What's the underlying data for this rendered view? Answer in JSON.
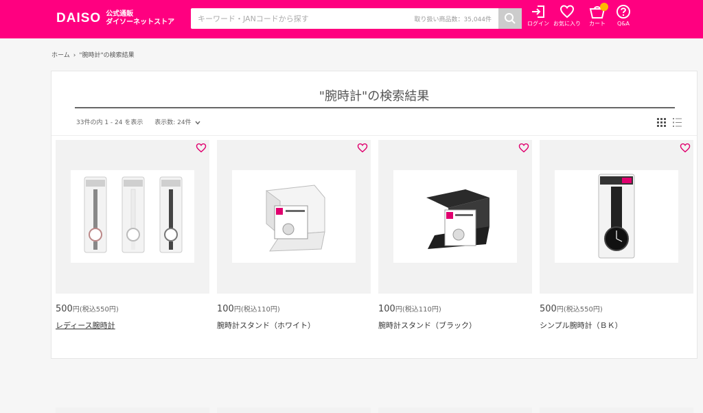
{
  "header": {
    "logo_word": "DAISO",
    "logo_sub_1": "公式通販",
    "logo_sub_2": "ダイソーネットストア",
    "brand_color": "#ff0080",
    "search": {
      "placeholder": "キーワード・JANコードから探す",
      "count_text": "取り扱い商品数：35,044件"
    },
    "icons": [
      {
        "name": "login-icon",
        "label": "ログイン"
      },
      {
        "name": "heart-icon",
        "label": "お気に入り"
      },
      {
        "name": "cart-icon",
        "label": "カート"
      },
      {
        "name": "help-icon",
        "label": "Q&A"
      }
    ]
  },
  "breadcrumb": {
    "home": "ホーム",
    "separator": "›",
    "current": "\"腕時計\"の検索結果"
  },
  "results": {
    "title": "\"腕時計\"の検索結果",
    "range_text": "33件の内 1 - 24 を表示",
    "per_page": "表示数: 24件"
  },
  "products": [
    {
      "price": "500",
      "price_unit": "円",
      "tax_text": "(税込550円)",
      "name": "レディース腕時計",
      "image": "three-packaged-watches",
      "underline": true
    },
    {
      "price": "100",
      "price_unit": "円",
      "tax_text": "(税込110円)",
      "name": "腕時計スタンド（ホワイト）",
      "image": "white-watch-stand",
      "underline": false
    },
    {
      "price": "100",
      "price_unit": "円",
      "tax_text": "(税込110円)",
      "name": "腕時計スタンド（ブラック）",
      "image": "black-watch-stand",
      "underline": false
    },
    {
      "price": "500",
      "price_unit": "円",
      "tax_text": "(税込550円)",
      "name": "シンプル腕時計（ＢＫ）",
      "image": "black-packaged-watch",
      "underline": false
    }
  ]
}
